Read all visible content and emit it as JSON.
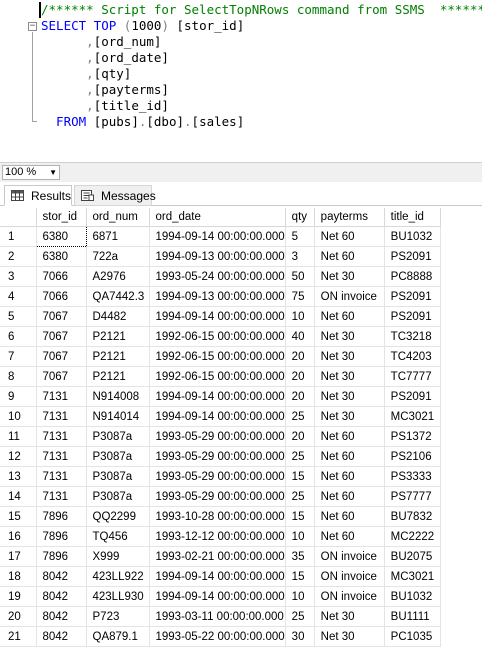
{
  "editor": {
    "lines": [
      {
        "parts": [
          {
            "t": "/****** Script for SelectTopNRows command from SSMS  ******/",
            "c": "cm"
          }
        ]
      },
      {
        "parts": [
          {
            "t": "SELECT",
            "c": "kw"
          },
          {
            "t": " TOP ",
            "c": "kw"
          },
          {
            "t": "(",
            "c": "gr"
          },
          {
            "t": "1000",
            "c": ""
          },
          {
            "t": ") ",
            "c": "gr"
          },
          {
            "t": "[stor_id]",
            "c": ""
          }
        ]
      },
      {
        "parts": [
          {
            "t": "      ,",
            "c": "gr"
          },
          {
            "t": "[ord_num]",
            "c": ""
          }
        ]
      },
      {
        "parts": [
          {
            "t": "      ,",
            "c": "gr"
          },
          {
            "t": "[ord_date]",
            "c": ""
          }
        ]
      },
      {
        "parts": [
          {
            "t": "      ,",
            "c": "gr"
          },
          {
            "t": "[qty]",
            "c": ""
          }
        ]
      },
      {
        "parts": [
          {
            "t": "      ,",
            "c": "gr"
          },
          {
            "t": "[payterms]",
            "c": ""
          }
        ]
      },
      {
        "parts": [
          {
            "t": "      ,",
            "c": "gr"
          },
          {
            "t": "[title_id]",
            "c": ""
          }
        ]
      },
      {
        "parts": [
          {
            "t": "  FROM ",
            "c": "kw"
          },
          {
            "t": "[pubs]",
            "c": ""
          },
          {
            "t": ".",
            "c": "gr"
          },
          {
            "t": "[dbo]",
            "c": ""
          },
          {
            "t": ".",
            "c": "gr"
          },
          {
            "t": "[sales]",
            "c": ""
          }
        ]
      }
    ]
  },
  "zoom": {
    "value": "100 %"
  },
  "tabs": {
    "results": "Results",
    "messages": "Messages"
  },
  "grid": {
    "columns": [
      "stor_id",
      "ord_num",
      "ord_date",
      "qty",
      "payterms",
      "title_id"
    ],
    "rows": [
      [
        "1",
        "6380",
        "6871",
        "1994-09-14 00:00:00.000",
        "5",
        "Net 60",
        "BU1032"
      ],
      [
        "2",
        "6380",
        "722a",
        "1994-09-13 00:00:00.000",
        "3",
        "Net 60",
        "PS2091"
      ],
      [
        "3",
        "7066",
        "A2976",
        "1993-05-24 00:00:00.000",
        "50",
        "Net 30",
        "PC8888"
      ],
      [
        "4",
        "7066",
        "QA7442.3",
        "1994-09-13 00:00:00.000",
        "75",
        "ON invoice",
        "PS2091"
      ],
      [
        "5",
        "7067",
        "D4482",
        "1994-09-14 00:00:00.000",
        "10",
        "Net 60",
        "PS2091"
      ],
      [
        "6",
        "7067",
        "P2121",
        "1992-06-15 00:00:00.000",
        "40",
        "Net 30",
        "TC3218"
      ],
      [
        "7",
        "7067",
        "P2121",
        "1992-06-15 00:00:00.000",
        "20",
        "Net 30",
        "TC4203"
      ],
      [
        "8",
        "7067",
        "P2121",
        "1992-06-15 00:00:00.000",
        "20",
        "Net 30",
        "TC7777"
      ],
      [
        "9",
        "7131",
        "N914008",
        "1994-09-14 00:00:00.000",
        "20",
        "Net 30",
        "PS2091"
      ],
      [
        "10",
        "7131",
        "N914014",
        "1994-09-14 00:00:00.000",
        "25",
        "Net 30",
        "MC3021"
      ],
      [
        "11",
        "7131",
        "P3087a",
        "1993-05-29 00:00:00.000",
        "20",
        "Net 60",
        "PS1372"
      ],
      [
        "12",
        "7131",
        "P3087a",
        "1993-05-29 00:00:00.000",
        "25",
        "Net 60",
        "PS2106"
      ],
      [
        "13",
        "7131",
        "P3087a",
        "1993-05-29 00:00:00.000",
        "15",
        "Net 60",
        "PS3333"
      ],
      [
        "14",
        "7131",
        "P3087a",
        "1993-05-29 00:00:00.000",
        "25",
        "Net 60",
        "PS7777"
      ],
      [
        "15",
        "7896",
        "QQ2299",
        "1993-10-28 00:00:00.000",
        "15",
        "Net 60",
        "BU7832"
      ],
      [
        "16",
        "7896",
        "TQ456",
        "1993-12-12 00:00:00.000",
        "10",
        "Net 60",
        "MC2222"
      ],
      [
        "17",
        "7896",
        "X999",
        "1993-02-21 00:00:00.000",
        "35",
        "ON invoice",
        "BU2075"
      ],
      [
        "18",
        "8042",
        "423LL922",
        "1994-09-14 00:00:00.000",
        "15",
        "ON invoice",
        "MC3021"
      ],
      [
        "19",
        "8042",
        "423LL930",
        "1994-09-14 00:00:00.000",
        "10",
        "ON invoice",
        "BU1032"
      ],
      [
        "20",
        "8042",
        "P723",
        "1993-03-11 00:00:00.000",
        "25",
        "Net 30",
        "BU1111"
      ],
      [
        "21",
        "8042",
        "QA879.1",
        "1993-05-22 00:00:00.000",
        "30",
        "Net 30",
        "PC1035"
      ]
    ]
  }
}
